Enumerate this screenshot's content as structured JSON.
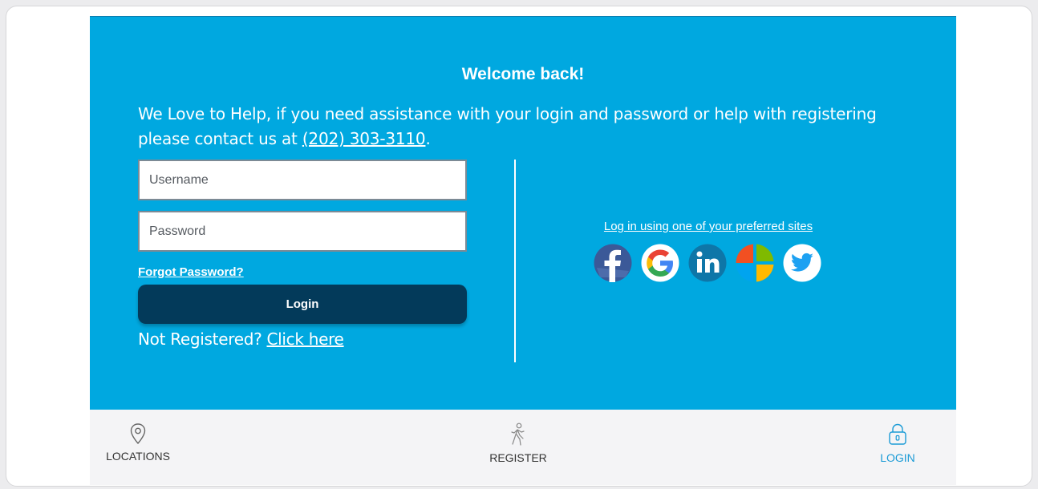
{
  "panel": {
    "title": "Welcome back!",
    "help_text": "We Love to Help, if you need assistance with your login and password or help with registering please contact us at ",
    "phone": "(202) 303-3110",
    "help_suffix": "."
  },
  "form": {
    "username_placeholder": "Username",
    "password_placeholder": "Password",
    "forgot_label": "Forgot Password?",
    "login_label": "Login",
    "not_registered_text": "Not Registered? ",
    "click_here_label": "Click here"
  },
  "social": {
    "label": "Log in using one of your preferred sites",
    "providers": [
      "facebook-icon",
      "google-icon",
      "linkedin-icon",
      "microsoft-icon",
      "twitter-icon"
    ]
  },
  "nav": {
    "locations_label": "LOCATIONS",
    "register_label": "REGISTER",
    "login_label": "LOGIN",
    "active_color": "#1b9bd6"
  },
  "colors": {
    "panel_bg": "#00a8e0",
    "button_bg": "#033a5a"
  }
}
